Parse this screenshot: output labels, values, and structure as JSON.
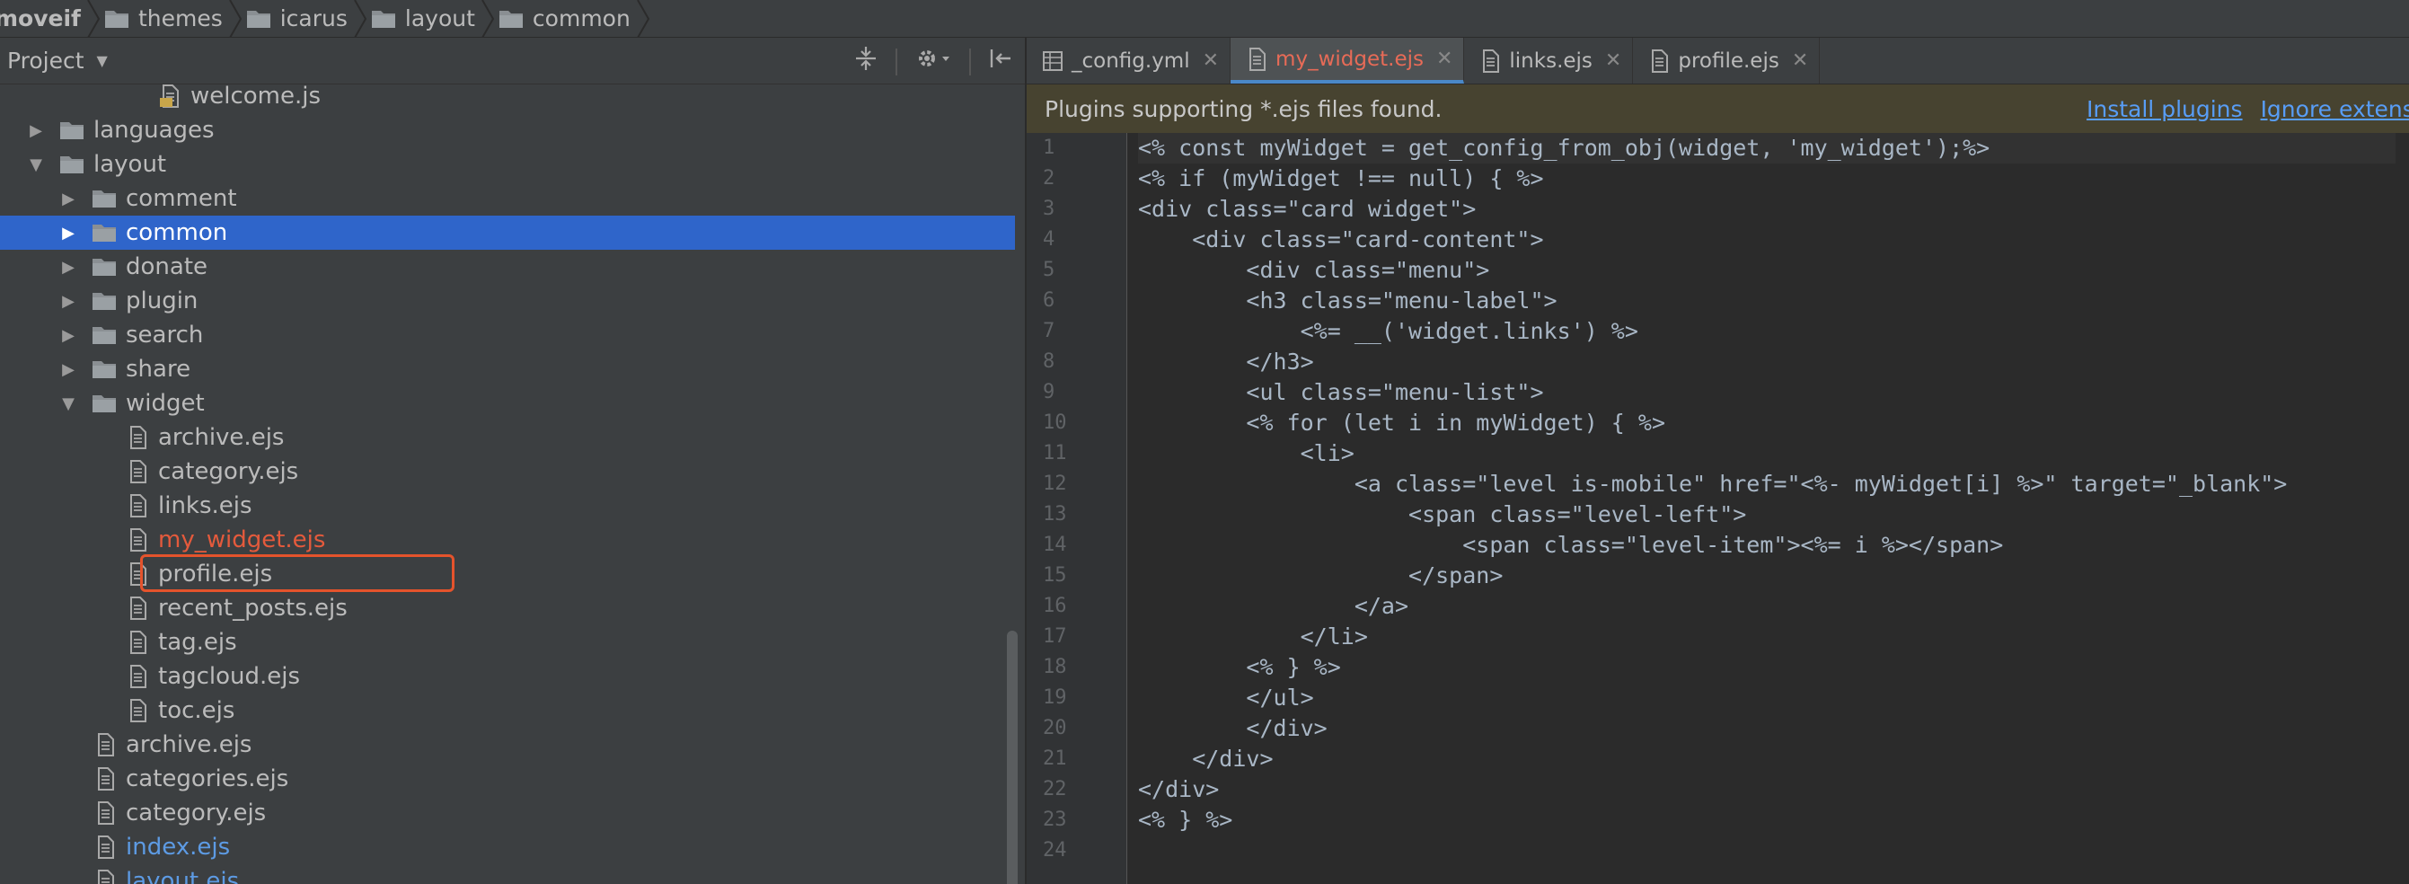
{
  "breadcrumb": {
    "items": [
      "moveif",
      "themes",
      "icarus",
      "layout",
      "common"
    ]
  },
  "project_panel": {
    "title": "Project",
    "tree": [
      {
        "label": "welcome.js",
        "type": "js",
        "depth": 5,
        "arrow": ""
      },
      {
        "label": "languages",
        "type": "folder",
        "depth": 2,
        "arrow": "▶"
      },
      {
        "label": "layout",
        "type": "folder",
        "depth": 2,
        "arrow": "▼"
      },
      {
        "label": "comment",
        "type": "folder",
        "depth": 3,
        "arrow": "▶"
      },
      {
        "label": "common",
        "type": "folder",
        "depth": 3,
        "arrow": "▶",
        "selected": true
      },
      {
        "label": "donate",
        "type": "folder",
        "depth": 3,
        "arrow": "▶"
      },
      {
        "label": "plugin",
        "type": "folder",
        "depth": 3,
        "arrow": "▶"
      },
      {
        "label": "search",
        "type": "folder",
        "depth": 3,
        "arrow": "▶"
      },
      {
        "label": "share",
        "type": "folder",
        "depth": 3,
        "arrow": "▶"
      },
      {
        "label": "widget",
        "type": "folder",
        "depth": 3,
        "arrow": "▼"
      },
      {
        "label": "archive.ejs",
        "type": "file",
        "depth": 4
      },
      {
        "label": "category.ejs",
        "type": "file",
        "depth": 4
      },
      {
        "label": "links.ejs",
        "type": "file",
        "depth": 4
      },
      {
        "label": "my_widget.ejs",
        "type": "file",
        "depth": 4,
        "style": "red"
      },
      {
        "label": "profile.ejs",
        "type": "file",
        "depth": 4
      },
      {
        "label": "recent_posts.ejs",
        "type": "file",
        "depth": 4
      },
      {
        "label": "tag.ejs",
        "type": "file",
        "depth": 4
      },
      {
        "label": "tagcloud.ejs",
        "type": "file",
        "depth": 4
      },
      {
        "label": "toc.ejs",
        "type": "file",
        "depth": 4
      },
      {
        "label": "archive.ejs",
        "type": "file",
        "depth": 3
      },
      {
        "label": "categories.ejs",
        "type": "file",
        "depth": 3
      },
      {
        "label": "category.ejs",
        "type": "file",
        "depth": 3
      },
      {
        "label": "index.ejs",
        "type": "file",
        "depth": 3,
        "style": "link"
      },
      {
        "label": "layout.ejs",
        "type": "file",
        "depth": 3,
        "style": "link"
      }
    ]
  },
  "tabs": [
    {
      "label": "_config.yml",
      "icon": "table-icon"
    },
    {
      "label": "my_widget.ejs",
      "icon": "file-icon",
      "active": true
    },
    {
      "label": "links.ejs",
      "icon": "file-icon"
    },
    {
      "label": "profile.ejs",
      "icon": "file-icon"
    }
  ],
  "notice": {
    "text": "Plugins supporting *.ejs files found.",
    "install": "Install plugins",
    "ignore": "Ignore extensi"
  },
  "code": [
    "<% const myWidget = get_config_from_obj(widget, 'my_widget');%>",
    "<% if (myWidget !== null) { %>",
    "<div class=\"card widget\">",
    "    <div class=\"card-content\">",
    "        <div class=\"menu\">",
    "        <h3 class=\"menu-label\">",
    "            <%= __('widget.links') %>",
    "        </h3>",
    "        <ul class=\"menu-list\">",
    "        <% for (let i in myWidget) { %>",
    "            <li>",
    "                <a class=\"level is-mobile\" href=\"<%- myWidget[i] %>\" target=\"_blank\">",
    "                    <span class=\"level-left\">",
    "                        <span class=\"level-item\"><%= i %></span>",
    "                    </span>",
    "                </a>",
    "            </li>",
    "        <% } %>",
    "        </ul>",
    "        </div>",
    "    </div>",
    "</div>",
    "<% } %>",
    ""
  ]
}
